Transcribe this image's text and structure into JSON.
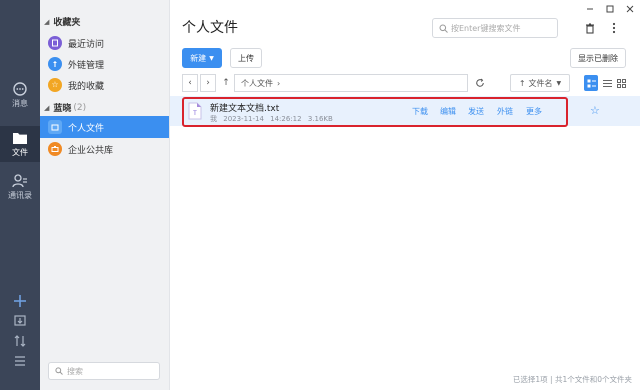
{
  "rail": {
    "items": [
      {
        "label": "消息",
        "icon": "chat-bubble-icon"
      },
      {
        "label": "文件",
        "icon": "folder-icon"
      },
      {
        "label": "通讯录",
        "icon": "contacts-icon"
      }
    ],
    "bottom_icons": [
      "plus-icon",
      "download-icon",
      "transfer-icon",
      "menu-icon"
    ]
  },
  "nav": {
    "favorites_title": "收藏夹",
    "favorites": [
      {
        "label": "最近访问",
        "icon": "recent-icon",
        "color": "#7b5fd6"
      },
      {
        "label": "外链管理",
        "icon": "link-icon",
        "color": "#3b8ff0"
      },
      {
        "label": "我的收藏",
        "icon": "star-icon",
        "color": "#f2a623"
      }
    ],
    "group_title": "蓝晓",
    "group_count": "(2)",
    "group_items": [
      {
        "label": "个人文件",
        "icon": "personal-folder-icon",
        "color": "#3b8ff0"
      },
      {
        "label": "企业公共库",
        "icon": "library-icon",
        "color": "#f08a24"
      }
    ],
    "search_placeholder": "搜索"
  },
  "header": {
    "title": "个人文件",
    "search_placeholder": "按Enter键搜索文件"
  },
  "toolbar": {
    "new_label": "新建",
    "upload_label": "上传",
    "show_deleted_label": "显示已删除"
  },
  "pathbar": {
    "path": "个人文件",
    "sort_label": "文件名"
  },
  "file": {
    "name": "新建文本文档.txt",
    "owner": "我",
    "modified": "2023-11-14 14:26:12",
    "size": "3.16KB",
    "actions": [
      "下载",
      "编辑",
      "发送",
      "外链",
      "更多"
    ]
  },
  "status": {
    "text": "已选择1项 | 共1个文件和0个文件夹"
  },
  "colors": {
    "accent": "#3b8ff0",
    "rail": "#3b4558",
    "highlight": "#d9232d"
  }
}
